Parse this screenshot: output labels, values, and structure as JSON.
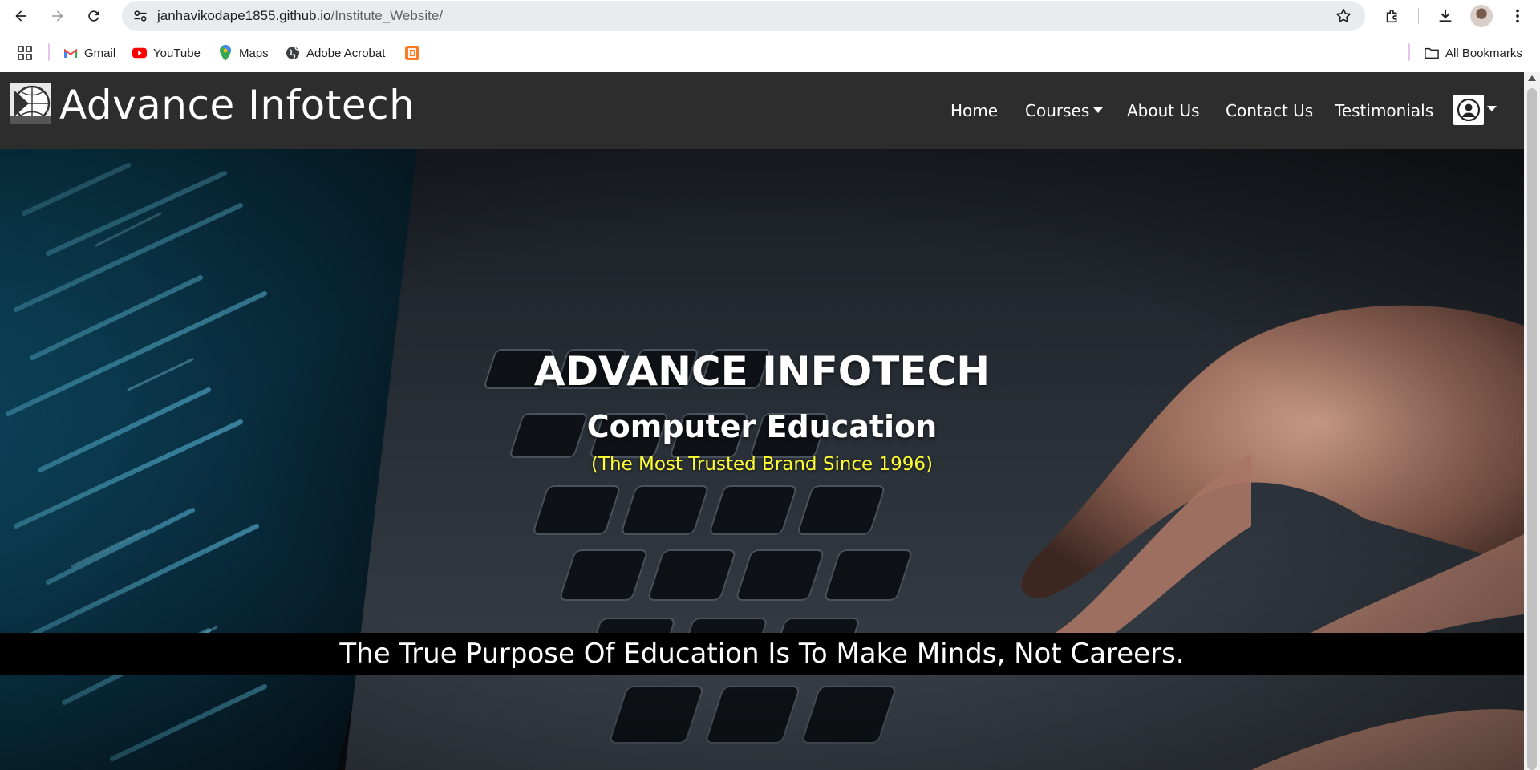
{
  "browser": {
    "url_host": "janhavikodape1855.github.io",
    "url_path": "/Institute_Website/",
    "bookmarks": [
      {
        "label": "Gmail",
        "icon": "gmail-icon"
      },
      {
        "label": "YouTube",
        "icon": "youtube-icon"
      },
      {
        "label": "Maps",
        "icon": "maps-icon"
      },
      {
        "label": "Adobe Acrobat",
        "icon": "globe-icon"
      },
      {
        "label": "",
        "icon": "xampp-icon"
      }
    ],
    "all_bookmarks_label": "All Bookmarks"
  },
  "navbar": {
    "brand": "Advance Infotech",
    "links": [
      {
        "label": "Home"
      },
      {
        "label": "Courses",
        "dropdown": true
      },
      {
        "label": "About Us"
      },
      {
        "label": "Contact Us"
      },
      {
        "label": "Testimonials"
      }
    ]
  },
  "hero": {
    "title": "ADVANCE INFOTECH",
    "subtitle": "Computer Education",
    "tagline": "(The Most Trusted Brand Since 1996)",
    "quote": "The True Purpose Of Education Is To Make Minds, Not Careers."
  },
  "colors": {
    "navbar_bg": "#2d2d2d",
    "tagline": "#ffff33",
    "quote_bar": "#000000"
  }
}
